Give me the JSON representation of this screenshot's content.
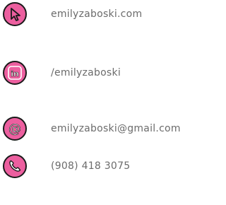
{
  "colors": {
    "icon_fill": "#ec5f9f",
    "icon_outline": "#1a1a1a",
    "text": "#6b6b6b"
  },
  "contacts": [
    {
      "icon": "cursor-pointer-icon",
      "text": "emilyzaboski.com"
    },
    {
      "icon": "linkedin-icon",
      "text": "/emilyzaboski",
      "icon_text": "in"
    },
    {
      "icon": "at-sign-icon",
      "text": "emilyzaboski@gmail.com",
      "icon_text": "@"
    },
    {
      "icon": "phone-icon",
      "text": "(908) 418 3075"
    }
  ]
}
